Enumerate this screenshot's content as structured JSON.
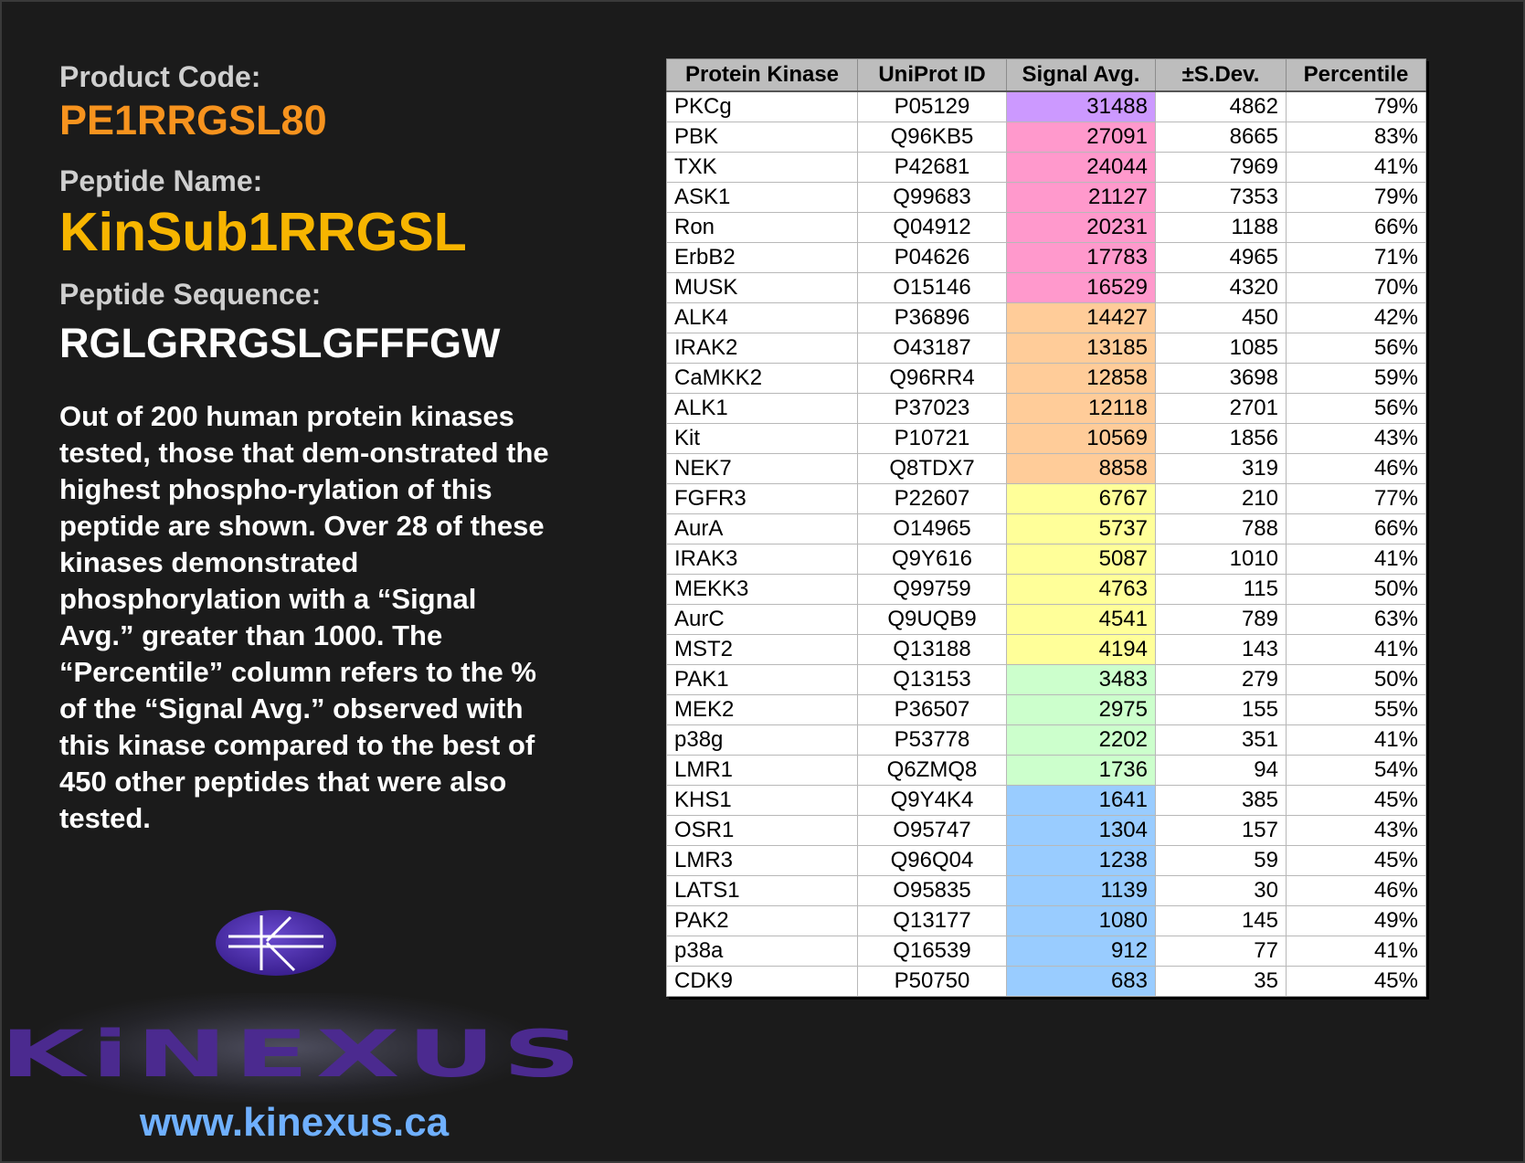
{
  "product_label": "Product Code:",
  "product_code": "PE1RRGSL80",
  "peptide_name_label": "Peptide Name:",
  "peptide_name": "KinSub1RRGSL",
  "sequence_label": "Peptide Sequence:",
  "sequence": "RGLGRRGSLGFFFGW",
  "description": "Out of 200 human protein kinases tested, those that dem-onstrated the highest phospho-rylation of this peptide are shown. Over 28 of these kinases demonstrated phosphorylation with a “Signal Avg.” greater than 1000. The “Percentile” column refers to the % of the “Signal Avg.” observed with this kinase compared to the best of 450 other peptides that were also tested.",
  "logo": {
    "wordmark": "KiNEXUS",
    "url": "www.kinexus.ca"
  },
  "table": {
    "headers": [
      "Protein Kinase",
      "UniProt ID",
      "Signal Avg.",
      "±S.Dev.",
      "Percentile"
    ],
    "rows": [
      [
        "PKCg",
        "P05129",
        "31488",
        "4862",
        "79%"
      ],
      [
        "PBK",
        "Q96KB5",
        "27091",
        "8665",
        "83%"
      ],
      [
        "TXK",
        "P42681",
        "24044",
        "7969",
        "41%"
      ],
      [
        "ASK1",
        "Q99683",
        "21127",
        "7353",
        "79%"
      ],
      [
        "Ron",
        "Q04912",
        "20231",
        "1188",
        "66%"
      ],
      [
        "ErbB2",
        "P04626",
        "17783",
        "4965",
        "71%"
      ],
      [
        "MUSK",
        "O15146",
        "16529",
        "4320",
        "70%"
      ],
      [
        "ALK4",
        "P36896",
        "14427",
        "450",
        "42%"
      ],
      [
        "IRAK2",
        "O43187",
        "13185",
        "1085",
        "56%"
      ],
      [
        "CaMKK2",
        "Q96RR4",
        "12858",
        "3698",
        "59%"
      ],
      [
        "ALK1",
        "P37023",
        "12118",
        "2701",
        "56%"
      ],
      [
        "Kit",
        "P10721",
        "10569",
        "1856",
        "43%"
      ],
      [
        "NEK7",
        "Q8TDX7",
        "8858",
        "319",
        "46%"
      ],
      [
        "FGFR3",
        "P22607",
        "6767",
        "210",
        "77%"
      ],
      [
        "AurA",
        "O14965",
        "5737",
        "788",
        "66%"
      ],
      [
        "IRAK3",
        "Q9Y616",
        "5087",
        "1010",
        "41%"
      ],
      [
        "MEKK3",
        "Q99759",
        "4763",
        "115",
        "50%"
      ],
      [
        "AurC",
        "Q9UQB9",
        "4541",
        "789",
        "63%"
      ],
      [
        "MST2",
        "Q13188",
        "4194",
        "143",
        "41%"
      ],
      [
        "PAK1",
        "Q13153",
        "3483",
        "279",
        "50%"
      ],
      [
        "MEK2",
        "P36507",
        "2975",
        "155",
        "55%"
      ],
      [
        "p38g",
        "P53778",
        "2202",
        "351",
        "41%"
      ],
      [
        "LMR1",
        "Q6ZMQ8",
        "1736",
        "94",
        "54%"
      ],
      [
        "KHS1",
        "Q9Y4K4",
        "1641",
        "385",
        "45%"
      ],
      [
        "OSR1",
        "O95747",
        "1304",
        "157",
        "43%"
      ],
      [
        "LMR3",
        "Q96Q04",
        "1238",
        "59",
        "45%"
      ],
      [
        "LATS1",
        "O95835",
        "1139",
        "30",
        "46%"
      ],
      [
        "PAK2",
        "Q13177",
        "1080",
        "145",
        "49%"
      ],
      [
        "p38a",
        "Q16539",
        "912",
        "77",
        "41%"
      ],
      [
        "CDK9",
        "P50750",
        "683",
        "35",
        "45%"
      ]
    ],
    "signal_colors": [
      "#cc99ff",
      "#ff99cc",
      "#ff99cc",
      "#ff99cc",
      "#ff99cc",
      "#ff99cc",
      "#ff99cc",
      "#ffcc99",
      "#ffcc99",
      "#ffcc99",
      "#ffcc99",
      "#ffcc99",
      "#ffcc99",
      "#ffff99",
      "#ffff99",
      "#ffff99",
      "#ffff99",
      "#ffff99",
      "#ffff99",
      "#ccffcc",
      "#ccffcc",
      "#ccffcc",
      "#ccffcc",
      "#99ccff",
      "#99ccff",
      "#99ccff",
      "#99ccff",
      "#99ccff",
      "#99ccff",
      "#99ccff"
    ]
  },
  "colors": {
    "background": "#1b1b1b",
    "product_code": "#f7931e",
    "peptide_name": "#f7b500",
    "logo_purple": "#4b2a8f",
    "url": "#6fb0ff"
  }
}
